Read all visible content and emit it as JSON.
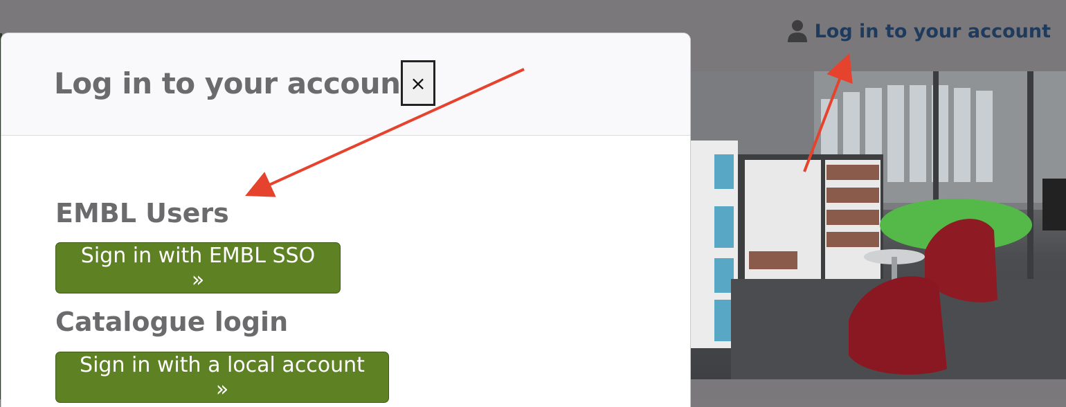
{
  "header": {
    "account_link_label": "Log in to your account",
    "account_icon": "user-icon"
  },
  "modal": {
    "title": "Log in to your account",
    "close_label": "×",
    "sections": [
      {
        "heading": "EMBL Users",
        "button_label": "Sign in with EMBL SSO »"
      },
      {
        "heading": "Catalogue login",
        "button_label": "Sign in with a local account »"
      }
    ]
  },
  "annotations": {
    "arrow_color": "#e5432d"
  },
  "colors": {
    "button_green": "#5e8124",
    "link_blue": "#1e3a5c",
    "heading_gray": "#6b6b6d",
    "overlay": "#7b797c"
  }
}
